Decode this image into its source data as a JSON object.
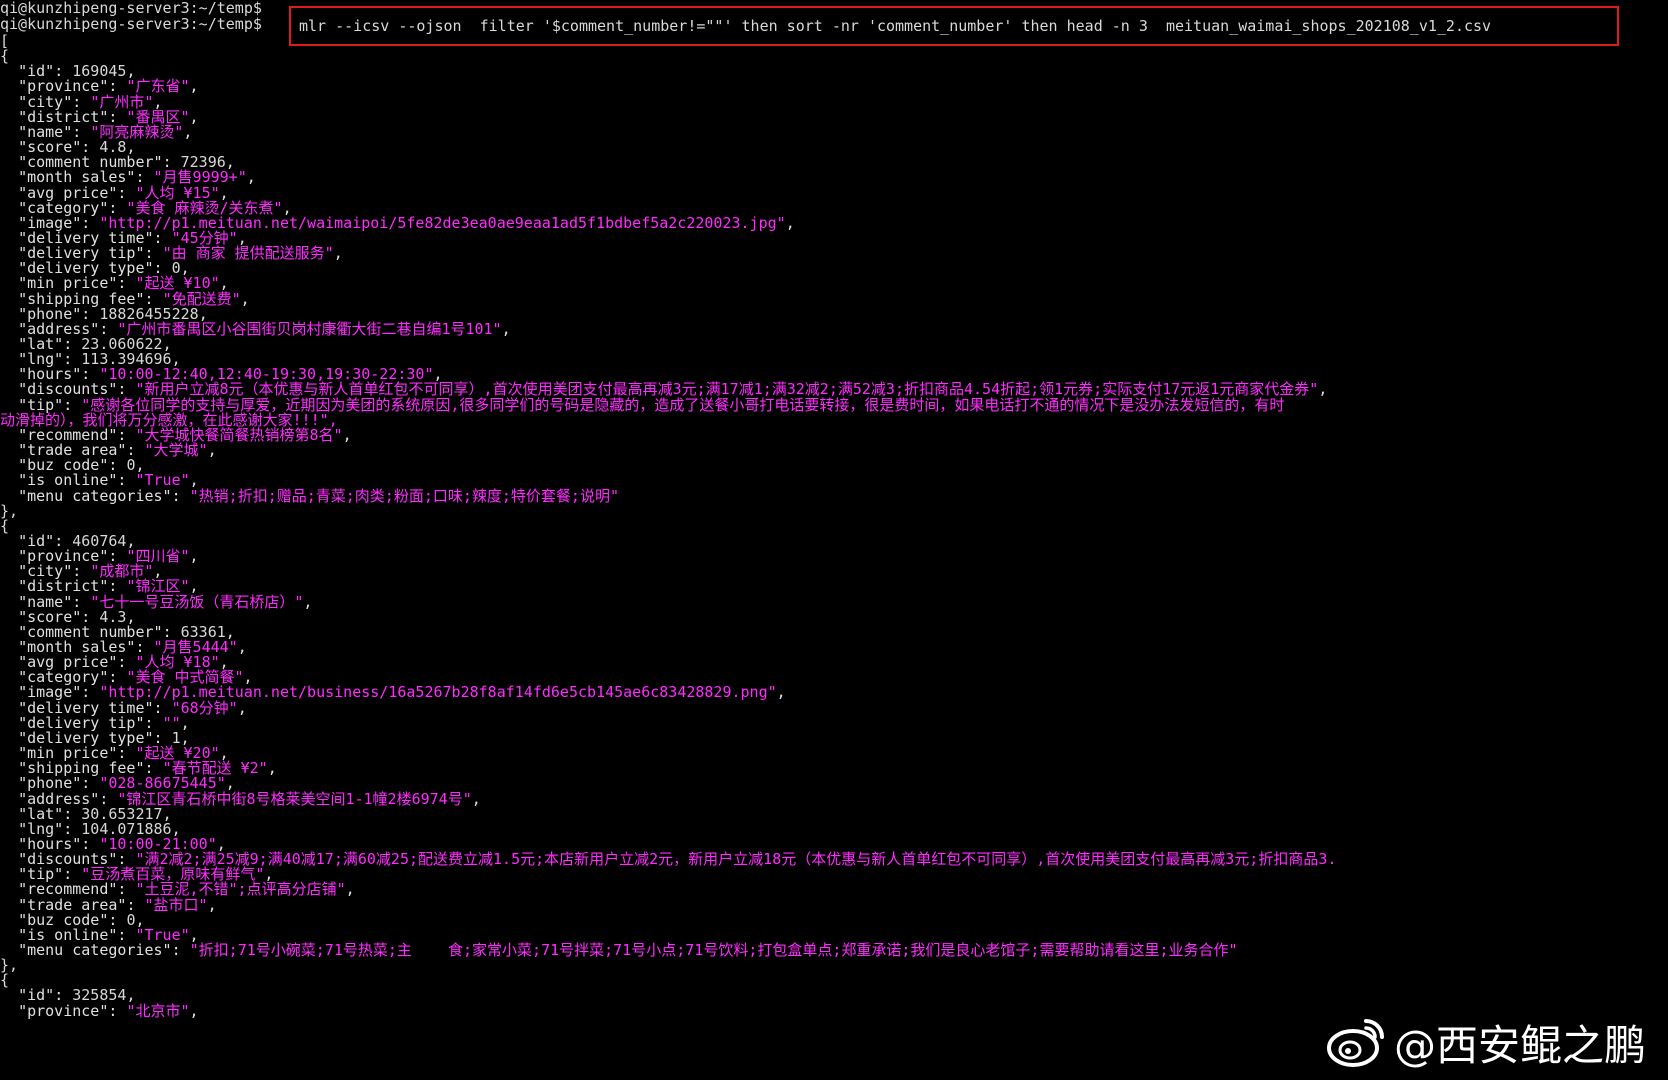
{
  "terminal": {
    "prompt1": "qi@kunzhipeng-server3:~/temp$",
    "prompt2": "qi@kunzhipeng-server3:~/temp$",
    "command": "mlr --icsv --ojson  filter '$comment_number!=\"\"' then sort -nr 'comment_number' then head -n 3  meituan_waimai_shops_202108_v1_2.csv",
    "highlight_color": "#e01b1b",
    "text_color": "#d8d8d8",
    "string_color": "#ff2bff",
    "lines": [
      {
        "text": "["
      },
      {
        "text": "{"
      },
      {
        "k": "id",
        "v": "169045",
        "t": "n"
      },
      {
        "k": "province",
        "v": "广东省",
        "t": "s"
      },
      {
        "k": "city",
        "v": "广州市",
        "t": "s"
      },
      {
        "k": "district",
        "v": "番禺区",
        "t": "s"
      },
      {
        "k": "name",
        "v": "阿亮麻辣烫",
        "t": "s"
      },
      {
        "k": "score",
        "v": "4.8",
        "t": "n"
      },
      {
        "k": "comment_number",
        "v": "72396",
        "t": "n"
      },
      {
        "k": "month_sales",
        "v": "月售9999+",
        "t": "s"
      },
      {
        "k": "avg_price",
        "v": "人均 ¥15",
        "t": "s"
      },
      {
        "k": "category",
        "v": "美食 麻辣烫/关东煮",
        "t": "s"
      },
      {
        "k": "image",
        "v": "http://p1.meituan.net/waimaipoi/5fe82de3ea0ae9eaa1ad5f1bdbef5a2c220023.jpg",
        "t": "s"
      },
      {
        "k": "delivery_time",
        "v": "45分钟",
        "t": "s"
      },
      {
        "k": "delivery_tip",
        "v": "由 商家 提供配送服务",
        "t": "s"
      },
      {
        "k": "delivery_type",
        "v": "0",
        "t": "n"
      },
      {
        "k": "min_price",
        "v": "起送 ¥10",
        "t": "s"
      },
      {
        "k": "shipping_fee",
        "v": "免配送费",
        "t": "s"
      },
      {
        "k": "phone",
        "v": "18826455228",
        "t": "n"
      },
      {
        "k": "address",
        "v": "广州市番禺区小谷围街贝岗村康衢大街二巷自编1号101",
        "t": "s"
      },
      {
        "k": "lat",
        "v": "23.060622",
        "t": "n"
      },
      {
        "k": "lng",
        "v": "113.394696",
        "t": "n"
      },
      {
        "k": "hours",
        "v": "10:00-12:40,12:40-19:30,19:30-22:30",
        "t": "s"
      },
      {
        "k": "discounts",
        "v": "新用户立减8元（本优惠与新人首单红包不可同享）,首次使用美团支付最高再减3元;满17减1;满32减2;满52减3;折扣商品4.54折起;领1元券;实际支付17元返1元商家代金券",
        "t": "s",
        "nocomma": true
      },
      {
        "k": "tip",
        "v": "感谢各位同学的支持与厚爱，近期因为美团的系统原因,很多同学们的号码是隐藏的，造成了送餐小哥打电话要转接，很是费时间，如果电话打不通的情况下是没办法发短信的，有时",
        "t": "s",
        "open": true
      },
      {
        "text": "动滑掉的），我们将万分感激，在此感谢大家!!!\",",
        "cont": true
      },
      {
        "k": "recommend",
        "v": "大学城快餐简餐热销榜第8名",
        "t": "s"
      },
      {
        "k": "trade_area",
        "v": "大学城",
        "t": "s"
      },
      {
        "k": "buz_code",
        "v": "0",
        "t": "n"
      },
      {
        "k": "is_online",
        "v": "True",
        "t": "s"
      },
      {
        "k": "menu_categories",
        "v": "热销;折扣;赠品;青菜;肉类;粉面;口味;辣度;特价套餐;说明",
        "t": "s",
        "last": true
      },
      {
        "text": "},"
      },
      {
        "text": "{"
      },
      {
        "k": "id",
        "v": "460764",
        "t": "n"
      },
      {
        "k": "province",
        "v": "四川省",
        "t": "s"
      },
      {
        "k": "city",
        "v": "成都市",
        "t": "s"
      },
      {
        "k": "district",
        "v": "锦江区",
        "t": "s"
      },
      {
        "k": "name",
        "v": "七十一号豆汤饭（青石桥店）",
        "t": "s"
      },
      {
        "k": "score",
        "v": "4.3",
        "t": "n"
      },
      {
        "k": "comment_number",
        "v": "63361",
        "t": "n"
      },
      {
        "k": "month_sales",
        "v": "月售5444",
        "t": "s"
      },
      {
        "k": "avg_price",
        "v": "人均 ¥18",
        "t": "s"
      },
      {
        "k": "category",
        "v": "美食 中式简餐",
        "t": "s"
      },
      {
        "k": "image",
        "v": "http://p1.meituan.net/business/16a5267b28f8af14fd6e5cb145ae6c83428829.png",
        "t": "s"
      },
      {
        "k": "delivery_time",
        "v": "68分钟",
        "t": "s"
      },
      {
        "k": "delivery_tip",
        "v": "",
        "t": "s"
      },
      {
        "k": "delivery_type",
        "v": "1",
        "t": "n"
      },
      {
        "k": "min_price",
        "v": "起送 ¥20",
        "t": "s"
      },
      {
        "k": "shipping_fee",
        "v": "春节配送 ¥2",
        "t": "s"
      },
      {
        "k": "phone",
        "v": "028-86675445",
        "t": "s"
      },
      {
        "k": "address",
        "v": "锦江区青石桥中街8号格莱美空间1-1幢2楼6974号",
        "t": "s"
      },
      {
        "k": "lat",
        "v": "30.653217",
        "t": "n"
      },
      {
        "k": "lng",
        "v": "104.071886",
        "t": "n"
      },
      {
        "k": "hours",
        "v": "10:00-21:00",
        "t": "s"
      },
      {
        "k": "discounts",
        "v": "满2减2;满25减9;满40减17;满60减25;配送费立减1.5元;本店新用户立减2元，新用户立减18元（本优惠与新人首单红包不可同享）,首次使用美团支付最高再减3元;折扣商品3.",
        "t": "s",
        "open": true
      },
      {
        "k": "tip",
        "v": "豆汤煮百菜，原味有鲜气",
        "t": "s"
      },
      {
        "k": "recommend",
        "v": "土豆泥,不错\";点评高分店铺",
        "t": "s",
        "raw": true
      },
      {
        "k": "trade_area",
        "v": "盐市口",
        "t": "s"
      },
      {
        "k": "buz_code",
        "v": "0",
        "t": "n"
      },
      {
        "k": "is_online",
        "v": "True",
        "t": "s"
      },
      {
        "k": "menu_categories",
        "v": "折扣;71号小碗菜;71号热菜;主    食;家常小菜;71号拌菜;71号小点;71号饮料;打包盒单点;郑重承诺;我们是良心老馆子;需要帮助请看这里;业务合作",
        "t": "s",
        "last": true
      },
      {
        "text": "},"
      },
      {
        "text": "{"
      },
      {
        "k": "id",
        "v": "325854",
        "t": "n"
      },
      {
        "k": "province",
        "v": "北京市",
        "t": "s"
      }
    ]
  },
  "watermark": {
    "text": "@西安鲲之鹏",
    "icon": "weibo-logo-icon"
  }
}
